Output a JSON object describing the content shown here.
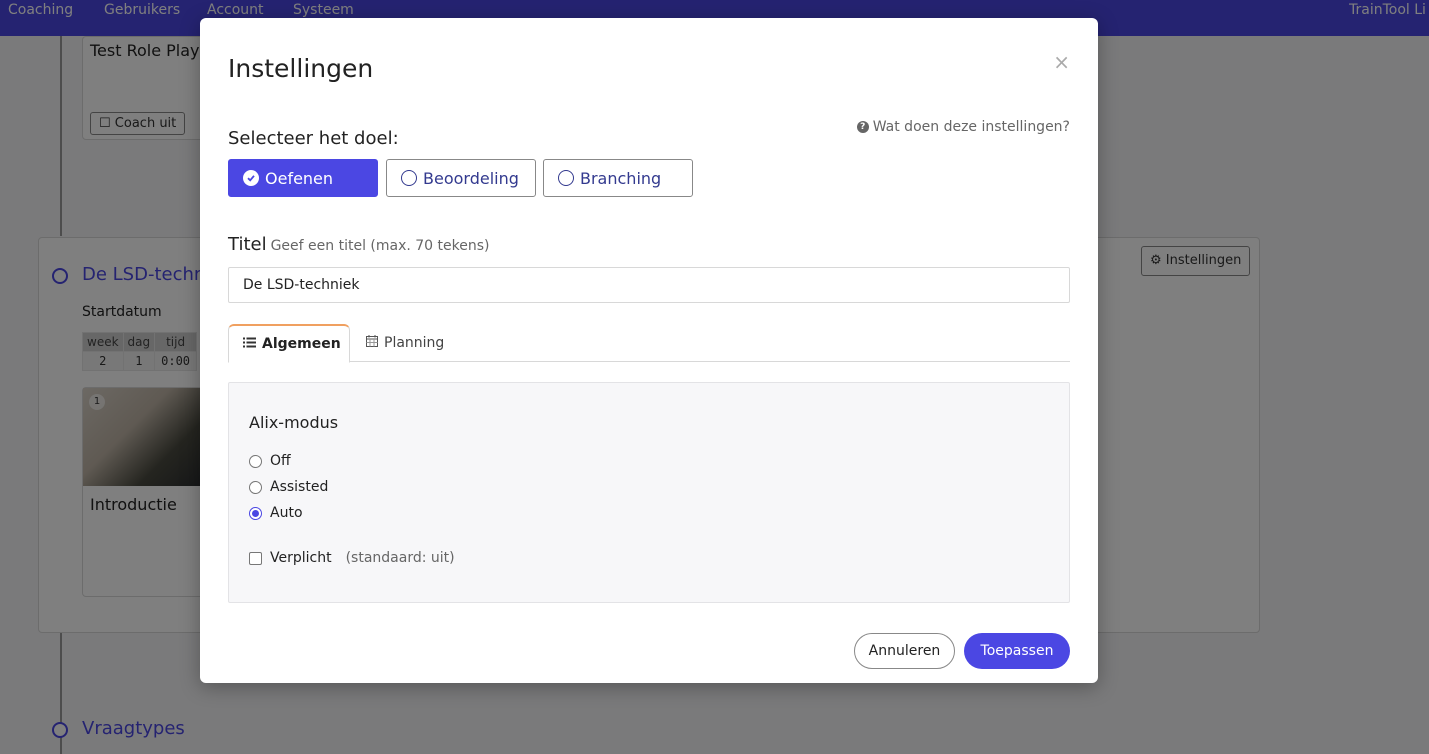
{
  "topnav": {
    "items": [
      "Coaching",
      "Gebruikers",
      "Account",
      "Systeem"
    ],
    "brand": "TrainTool Li"
  },
  "background": {
    "card1_title": "Test Role Play",
    "card1_button": "Coach uit",
    "section1_title": "De LSD-techn",
    "settings_button": "Instellingen",
    "startdate_label": "Startdatum",
    "date_headers": [
      "week",
      "dag",
      "tijd"
    ],
    "date_values": [
      "2",
      "1",
      "0:00"
    ],
    "thumb_badge": "1",
    "thumb_caption": "Introductie",
    "section2_title": "Vraagtypes"
  },
  "modal": {
    "title": "Instellingen",
    "close": "×",
    "help_link": "Wat doen deze instellingen?",
    "goal_label": "Selecteer het doel:",
    "goals": [
      {
        "label": "Oefenen",
        "selected": true
      },
      {
        "label": "Beoordeling",
        "selected": false
      },
      {
        "label": "Branching",
        "selected": false
      }
    ],
    "title_field_label": "Titel",
    "title_field_hint": "Geef een titel (max. 70 tekens)",
    "title_value": "De LSD-techniek",
    "tabs": [
      {
        "label": "Algemeen",
        "active": true,
        "icon": "list-icon"
      },
      {
        "label": "Planning",
        "active": false,
        "icon": "calendar-icon"
      }
    ],
    "panel": {
      "heading": "Alix-modus",
      "options": [
        {
          "label": "Off",
          "checked": false
        },
        {
          "label": "Assisted",
          "checked": false
        },
        {
          "label": "Auto",
          "checked": true
        }
      ],
      "required_label": "Verplicht",
      "required_default": "(standaard: uit)",
      "required_checked": false
    },
    "cancel_label": "Annuleren",
    "apply_label": "Toepassen"
  },
  "colors": {
    "accent": "#4b47e3",
    "tab_highlight": "#f0a060",
    "overlay": "rgba(0,0,0,0.5)"
  }
}
